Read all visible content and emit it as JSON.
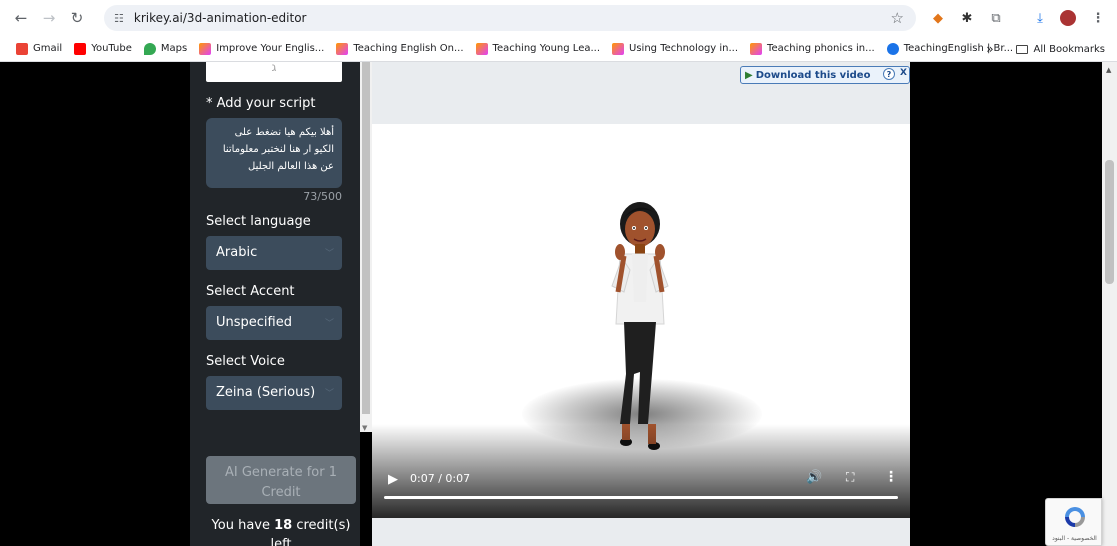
{
  "browser": {
    "url": "krikey.ai/3d-animation-editor",
    "bookmarks": [
      {
        "label": "Gmail",
        "color": "#ea4335"
      },
      {
        "label": "YouTube",
        "color": "#ff0000"
      },
      {
        "label": "Maps",
        "color": "#34a853"
      },
      {
        "label": "Improve Your Englis...",
        "color": "#e040fb"
      },
      {
        "label": "Teaching English On...",
        "color": "#e040fb"
      },
      {
        "label": "Teaching Young Lea...",
        "color": "#e040fb"
      },
      {
        "label": "Using Technology in...",
        "color": "#e040fb"
      },
      {
        "label": "Teaching phonics in...",
        "color": "#e040fb"
      },
      {
        "label": "TeachingEnglish | Br...",
        "color": "#1a73e8"
      }
    ],
    "overflow": "»",
    "all_bookmarks": "All Bookmarks"
  },
  "sidebar": {
    "thumb_text": "ג",
    "script_label": "* Add your script",
    "script_text": "أهلا بيكم هيا نضغط على الكيو ار هنا لنختبر معلوماتنا عن هذا العالم الجليل",
    "counter": "73/500",
    "language_label": "Select language",
    "language_value": "Arabic",
    "accent_label": "Select Accent",
    "accent_value": "Unspecified",
    "voice_label": "Select Voice",
    "voice_value": "Zeina (Serious)",
    "generate_label": "AI Generate for 1 Credit",
    "credits_prefix": "You have ",
    "credits_count": "18",
    "credits_suffix": " credit(s) left"
  },
  "player": {
    "download_label": "Download this video",
    "help": "?",
    "close": "X",
    "time": "0:07 / 0:07",
    "progress": 1.0
  },
  "recaptcha": {
    "text": "الخصوصية - البنود"
  }
}
